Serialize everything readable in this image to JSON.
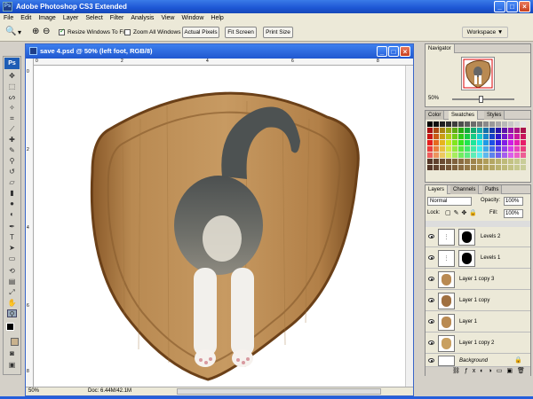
{
  "app": {
    "title": "Adobe Photoshop CS3 Extended",
    "ps_icon": "Ps",
    "toolbox_logo": "Ps"
  },
  "window_controls": {
    "minimize": "_",
    "maximize": "□",
    "close": "×"
  },
  "menu": [
    "File",
    "Edit",
    "Image",
    "Layer",
    "Select",
    "Filter",
    "Analysis",
    "View",
    "Window",
    "Help"
  ],
  "options": {
    "resize_windows": "Resize Windows To Fit",
    "zoom_all": "Zoom All Windows",
    "actual_pixels": "Actual Pixels",
    "fit_screen": "Fit Screen",
    "print_size": "Print Size",
    "workspace": "Workspace ▼",
    "zoom_tool_icon": "🔍",
    "zoom_in_icon": "⊕",
    "zoom_out_icon": "⊖",
    "dropdown_icon": "▾"
  },
  "document": {
    "title": "save 4.psd @ 50% (left foot, RGB/8)",
    "zoom": "50%",
    "doc_size": "Doc: 6.44M/42.1M",
    "ruler_top_ticks": [
      "0",
      "2",
      "4",
      "6",
      "8"
    ],
    "ruler_left_ticks": [
      "0",
      "2",
      "4",
      "6",
      "8"
    ]
  },
  "navigator": {
    "tab": "Navigator",
    "zoom": "50%"
  },
  "swatches_panel": {
    "tabs": [
      "Color",
      "Swatches",
      "Styles"
    ],
    "active": "Swatches"
  },
  "layers_panel": {
    "tabs": [
      "Layers",
      "Channels",
      "Paths"
    ],
    "active": "Layers",
    "blend_mode": "Normal",
    "opacity_label": "Opacity:",
    "opacity": "100%",
    "lock_label": "Lock:",
    "fill_label": "Fill:",
    "fill": "100%",
    "layers": [
      {
        "name": "Levels 2",
        "kind": "adjustment"
      },
      {
        "name": "Levels 1",
        "kind": "adjustment"
      },
      {
        "name": "Layer 1 copy 3",
        "kind": "plaque"
      },
      {
        "name": "Layer 1 copy",
        "kind": "plaque"
      },
      {
        "name": "Layer 1",
        "kind": "plaque"
      },
      {
        "name": "Layer 1 copy 2",
        "kind": "plaque"
      },
      {
        "name": "Background",
        "kind": "background"
      }
    ]
  },
  "colors": {
    "titlebar": "#1d56d4",
    "panel": "#ece9d8",
    "wood": "#b98a52",
    "selected_layer": "#316ac5"
  }
}
